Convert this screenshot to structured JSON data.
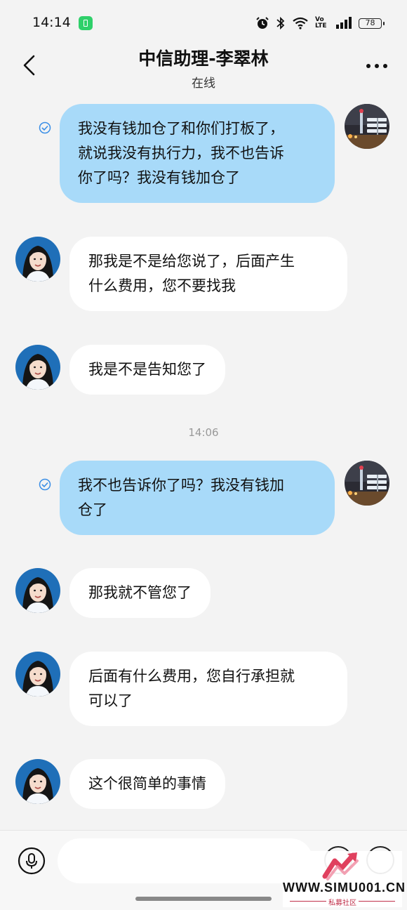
{
  "status_bar": {
    "time": "14:14",
    "battery": "78",
    "network": "Vo LTE",
    "icons": [
      "app-notification-icon",
      "alarm-icon",
      "bluetooth-icon",
      "wifi-icon",
      "volte-icon",
      "signal-icon",
      "battery-icon"
    ]
  },
  "header": {
    "title": "中信助理-李翠林",
    "status": "在线",
    "back_icon": "chevron-left-icon",
    "more_icon": "more-dots-icon"
  },
  "messages": [
    {
      "sender": "user",
      "lines": [
        "我没有钱加仓了和你们打板了，",
        "就说我没有执行力，我不也告诉",
        "你了吗？我没有钱加仓了"
      ],
      "read": true
    },
    {
      "sender": "agent",
      "lines": [
        "那我是不是给您说了，后面产生",
        "什么费用，您不要找我"
      ]
    },
    {
      "sender": "agent",
      "lines": [
        "我是不是告知您了"
      ]
    },
    {
      "sender": "user",
      "lines": [
        "我不也告诉你了吗？我没有钱加",
        "仓了"
      ],
      "read": true
    },
    {
      "sender": "agent",
      "lines": [
        "那我就不管您了"
      ]
    },
    {
      "sender": "agent",
      "lines": [
        "后面有什么费用，您自行承担就",
        "可以了"
      ]
    },
    {
      "sender": "agent",
      "lines": [
        "这个很简单的事情"
      ]
    }
  ],
  "time_divider": "14:06",
  "input_bar": {
    "placeholder": "",
    "icons": [
      "microphone-icon",
      "emoji-icon",
      "plus-icon"
    ]
  },
  "watermark": {
    "site": "WWW.SIMU001.CN",
    "subtitle": "私募社区"
  },
  "colors": {
    "background": "#f3f3f3",
    "outgoing_bubble": "#a8daf9",
    "incoming_bubble": "#ffffff",
    "read_check": "#3a8ee6",
    "watermark_accent": "#e0405e"
  }
}
